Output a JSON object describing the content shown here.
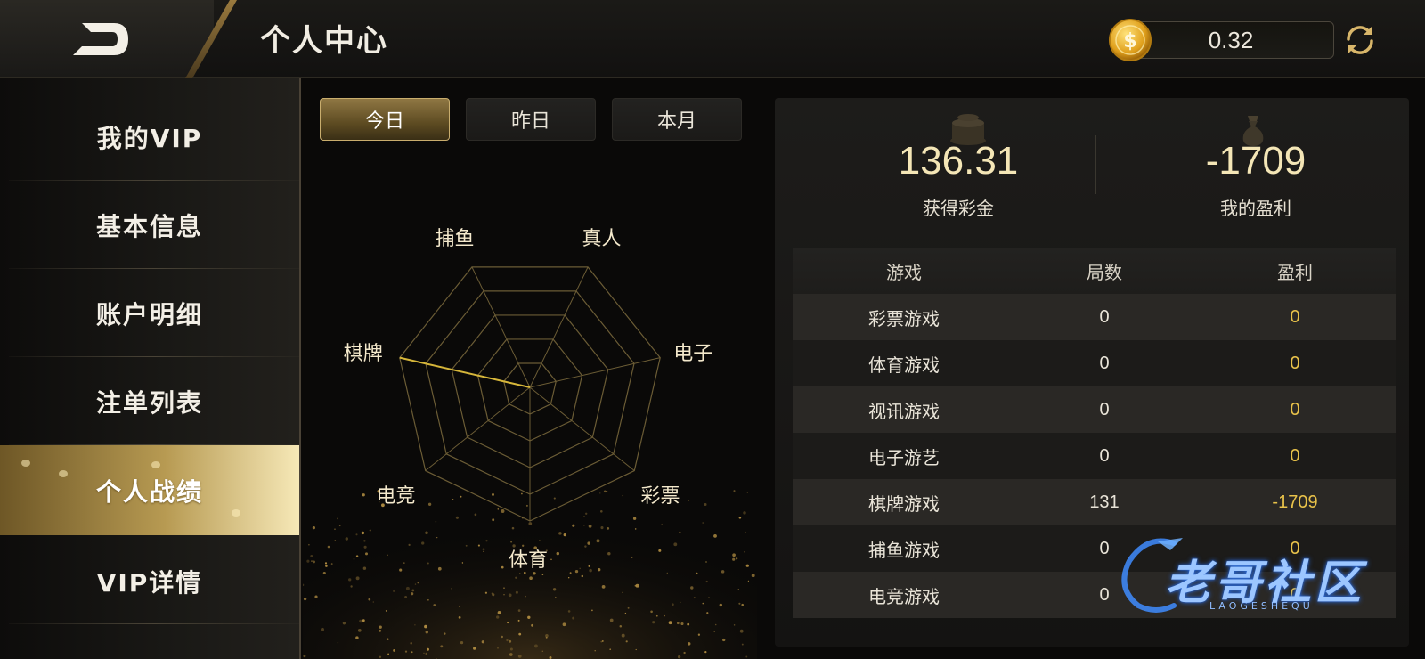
{
  "header": {
    "title": "个人中心",
    "balance": "0.32",
    "coin_icon": "coin-icon",
    "refresh_icon": "refresh-icon",
    "back_icon": "back-icon"
  },
  "sidebar": {
    "items": [
      {
        "label": "我的VIP",
        "active": false
      },
      {
        "label": "基本信息",
        "active": false
      },
      {
        "label": "账户明细",
        "active": false
      },
      {
        "label": "注单列表",
        "active": false
      },
      {
        "label": "个人战绩",
        "active": true
      },
      {
        "label": "VIP详情",
        "active": false
      }
    ]
  },
  "tabs": [
    {
      "label": "今日",
      "active": true
    },
    {
      "label": "昨日",
      "active": false
    },
    {
      "label": "本月",
      "active": false
    }
  ],
  "chart_data": {
    "type": "radar",
    "axes": [
      "捕鱼",
      "真人",
      "电子",
      "彩票",
      "体育",
      "电竞",
      "棋牌"
    ],
    "values": [
      0,
      0,
      0,
      0,
      0,
      0,
      1
    ],
    "rings": 5,
    "line_color": "#d6b63a",
    "grid_color": "#6b5c35"
  },
  "stats": {
    "bonus_value": "136.31",
    "bonus_label": "获得彩金",
    "profit_value": "-1709",
    "profit_label": "我的盈利"
  },
  "table": {
    "headers": [
      "游戏",
      "局数",
      "盈利"
    ],
    "rows": [
      [
        "彩票游戏",
        "0",
        "0"
      ],
      [
        "体育游戏",
        "0",
        "0"
      ],
      [
        "视讯游戏",
        "0",
        "0"
      ],
      [
        "电子游艺",
        "0",
        "0"
      ],
      [
        "棋牌游戏",
        "131",
        "-1709"
      ],
      [
        "捕鱼游戏",
        "0",
        "0"
      ],
      [
        "电竞游戏",
        "0",
        "0"
      ]
    ]
  },
  "watermark": {
    "text": "老哥社区",
    "sub": "LAOGESHEQU"
  },
  "colors": {
    "accent_gold": "#e8c24a",
    "active_gold": "#b79a52",
    "background": "#0a0908"
  }
}
